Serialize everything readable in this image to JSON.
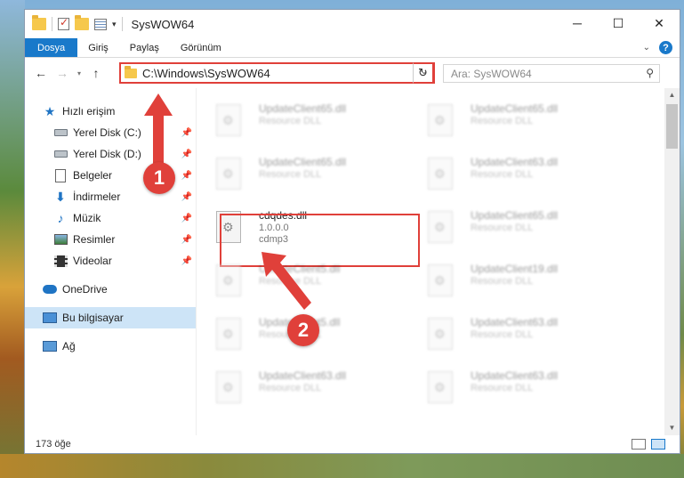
{
  "window": {
    "title": "SysWOW64"
  },
  "ribbon": {
    "tabs": [
      "Dosya",
      "Giriş",
      "Paylaş",
      "Görünüm"
    ]
  },
  "address": {
    "path": "C:\\Windows\\SysWOW64"
  },
  "search": {
    "placeholder": "Ara: SysWOW64"
  },
  "sidebar": {
    "items": [
      {
        "label": "Hızlı erişim"
      },
      {
        "label": "Yerel Disk (C:)"
      },
      {
        "label": "Yerel Disk (D:)"
      },
      {
        "label": "Belgeler"
      },
      {
        "label": "İndirmeler"
      },
      {
        "label": "Müzik"
      },
      {
        "label": "Resimler"
      },
      {
        "label": "Videolar"
      },
      {
        "label": "OneDrive"
      },
      {
        "label": "Bu bilgisayar"
      },
      {
        "label": "Ağ"
      }
    ]
  },
  "files": [
    {
      "name": "UpdateClient65.dll",
      "type": "Resource DLL"
    },
    {
      "name": "UpdateClient65.dll",
      "type": "Resource DLL"
    },
    {
      "name": "UpdateClient65.dll",
      "type": "Resource DLL"
    },
    {
      "name": "UpdateClient63.dll",
      "type": "Resource DLL"
    },
    {
      "name": "cdqdes.dll",
      "version": "1.0.0.0",
      "desc": "cdmp3"
    },
    {
      "name": "UpdateClient65.dll",
      "type": "Resource DLL"
    },
    {
      "name": "UpdateClient5.dll",
      "type": "Resource DLL"
    },
    {
      "name": "UpdateClient19.dll",
      "type": "Resource DLL"
    },
    {
      "name": "UpdateClient5.dll",
      "type": "Resource DLL"
    },
    {
      "name": "UpdateClient63.dll",
      "type": "Resource DLL"
    },
    {
      "name": "UpdateClient63.dll",
      "type": "Resource DLL"
    },
    {
      "name": "UpdateClient63.dll",
      "type": "Resource DLL"
    }
  ],
  "status": {
    "count": "173 öğe"
  },
  "annotations": {
    "step1": "1",
    "step2": "2"
  },
  "colors": {
    "accent": "#1979ca",
    "annotation": "#e0403a"
  }
}
